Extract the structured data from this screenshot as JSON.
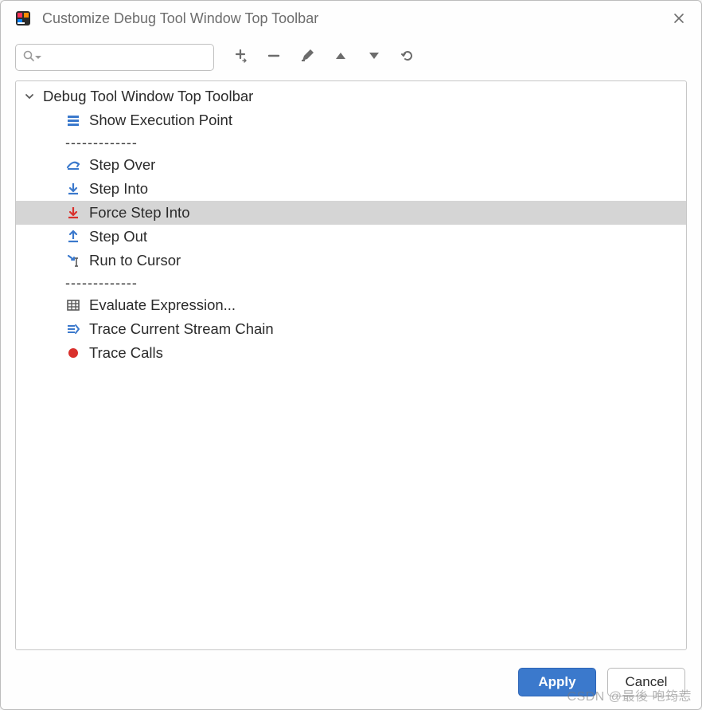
{
  "window": {
    "title": "Customize Debug Tool Window Top Toolbar"
  },
  "search": {
    "value": "",
    "placeholder": ""
  },
  "toolbar_buttons": {
    "add": "add-action",
    "remove": "remove-action",
    "edit": "edit-action",
    "move_up": "move-up",
    "move_down": "move-down",
    "restore": "restore-defaults"
  },
  "tree": {
    "root_label": "Debug Tool Window Top Toolbar",
    "expanded": true,
    "items": [
      {
        "type": "action",
        "label": "Show Execution Point",
        "icon": "show-execution-point-icon",
        "selected": false
      },
      {
        "type": "separator"
      },
      {
        "type": "action",
        "label": "Step Over",
        "icon": "step-over-icon",
        "selected": false
      },
      {
        "type": "action",
        "label": "Step Into",
        "icon": "step-into-icon",
        "selected": false
      },
      {
        "type": "action",
        "label": "Force Step Into",
        "icon": "force-step-into-icon",
        "selected": true
      },
      {
        "type": "action",
        "label": "Step Out",
        "icon": "step-out-icon",
        "selected": false
      },
      {
        "type": "action",
        "label": "Run to Cursor",
        "icon": "run-to-cursor-icon",
        "selected": false
      },
      {
        "type": "separator"
      },
      {
        "type": "action",
        "label": "Evaluate Expression...",
        "icon": "evaluate-expression-icon",
        "selected": false
      },
      {
        "type": "action",
        "label": "Trace Current Stream Chain",
        "icon": "trace-stream-icon",
        "selected": false
      },
      {
        "type": "action",
        "label": "Trace Calls",
        "icon": "trace-calls-icon",
        "selected": false
      }
    ]
  },
  "separator_text": "-------------",
  "footer": {
    "apply": "Apply",
    "cancel": "Cancel"
  },
  "watermark": "CSDN @最後 咆筠莣"
}
